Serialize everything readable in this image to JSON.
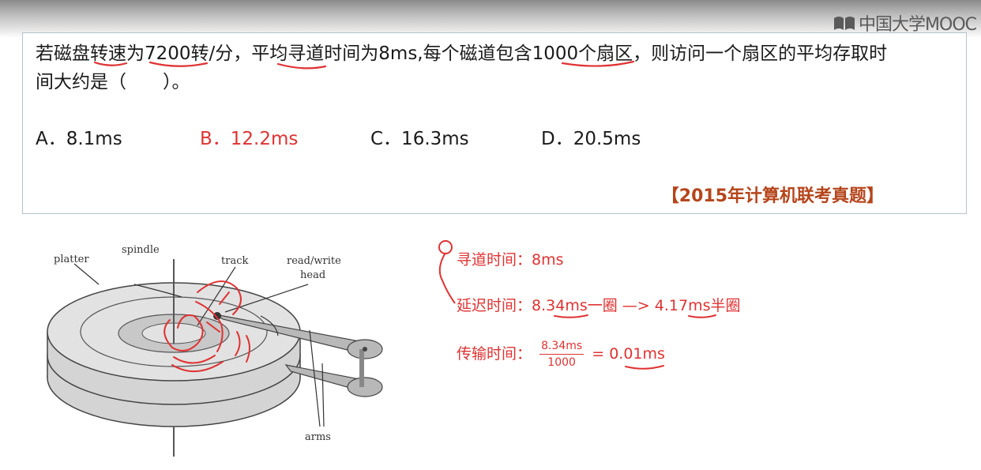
{
  "header": {
    "logo_text": "中国大学MOOC",
    "logo_icon": "mooc-logo-icon"
  },
  "question": {
    "text_line1": "若磁盘转速为7200转/分，平均寻道时间为8ms,每个磁道包含1000个扇区，则访问一个扇区的平均存取时",
    "text_line2": "间大约是（　　）。",
    "options": [
      {
        "label": "A．8.1ms"
      },
      {
        "label": "B．12.2ms"
      },
      {
        "label": "C．16.3ms"
      },
      {
        "label": "D．20.5ms"
      }
    ],
    "source": "【2015年计算机联考真题】"
  },
  "diagram_labels": {
    "platter": "platter",
    "spindle": "spindle",
    "track": "track",
    "head_line1": "read/write",
    "head_line2": "head",
    "arms": "arms"
  },
  "notes": {
    "seek_label": "寻道时间：",
    "seek_value": "8ms",
    "latency_label": "延迟时间：",
    "latency_value_full": "8.34ms",
    "latency_full_word": "一圈",
    "arrow": "—>",
    "latency_value_half": "4.17ms",
    "latency_half_word": "半圈",
    "transfer_label": "传输时间：",
    "transfer_numerator": "8.34ms",
    "transfer_denominator": "1000",
    "equals": "=",
    "transfer_value": "0.01ms"
  },
  "colors": {
    "accent_red": "#e03232",
    "source_orange": "#b5451b",
    "box_border": "#b4c2cc"
  }
}
